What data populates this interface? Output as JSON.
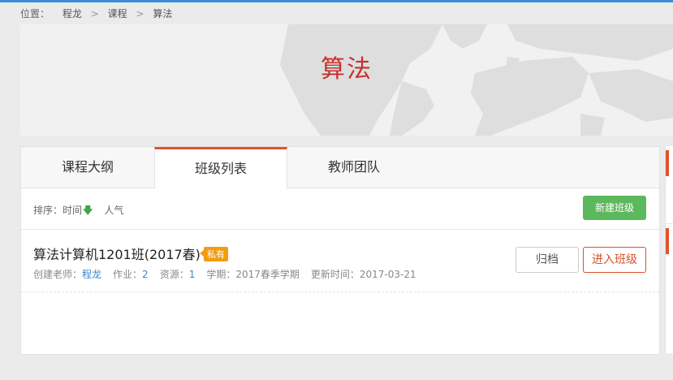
{
  "breadcrumb": {
    "prefix": "位置：",
    "items": [
      "程龙",
      "课程",
      "算法"
    ],
    "separator": ">"
  },
  "banner": {
    "title": "算法"
  },
  "tabs": [
    {
      "label": "课程大纲",
      "active": false
    },
    {
      "label": "班级列表",
      "active": true
    },
    {
      "label": "教师团队",
      "active": false
    }
  ],
  "toolbar": {
    "sort_label": "排序：",
    "sort_time": "时间",
    "sort_time_arrow": "🡇",
    "sort_popular": "人气",
    "new_class_button": "新建班级"
  },
  "class_item": {
    "name": "算法计算机1201班(2017春)",
    "badge": "私有",
    "creator_label": "创建老师：",
    "creator": "程龙",
    "homework_label": "作业：",
    "homework": "2",
    "resources_label": "资源：",
    "resources": "1",
    "term": "学期：2017春季学期",
    "updated": "更新时间：2017-03-21",
    "archive_button": "归档",
    "enter_button": "进入班级"
  },
  "colors": {
    "accent": "#e0542b",
    "banner_title": "#c8302c",
    "primary_button": "#5cb85c",
    "link": "#3a87c8",
    "badge": "#f39c12",
    "top_line": "#3b8fd6"
  }
}
